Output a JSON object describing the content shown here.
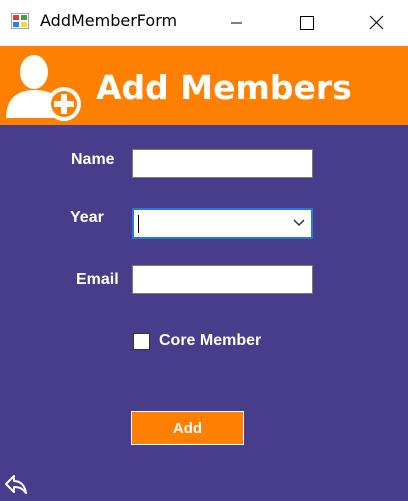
{
  "window": {
    "title": "AddMemberForm",
    "controls": [
      "minimize",
      "maximize",
      "close"
    ]
  },
  "banner": {
    "title": "Add Members",
    "icon": "add-user-icon",
    "background": "#ff8000"
  },
  "form": {
    "background": "#483d8b",
    "name_label": "Name",
    "name_value": "",
    "year_label": "Year",
    "year_value": "",
    "email_label": "Email",
    "email_value": "",
    "core_member_label": "Core Member",
    "core_member_checked": false,
    "add_button_label": "Add",
    "back_icon": "back-arrow-icon"
  }
}
